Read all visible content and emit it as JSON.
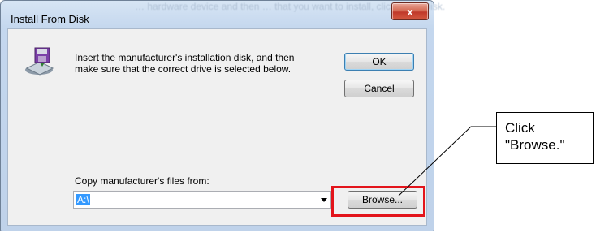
{
  "window": {
    "title": "Install From Disk",
    "background_hint": "… hardware device and then … that you want to install, click Have Disk.",
    "close_glyph": "x"
  },
  "dialog": {
    "message": "Insert the manufacturer's installation disk, and then make sure that the correct drive is selected below.",
    "ok_label": "OK",
    "cancel_label": "Cancel",
    "copy_from_label": "Copy manufacturer's files from:",
    "path_value": "A:\\",
    "browse_label": "Browse..."
  },
  "annotation": {
    "callout_text": "Click \"Browse.\"",
    "highlight_color": "#e3141b"
  },
  "icons": {
    "disk": "install-disk-icon",
    "dropdown": "chevron-down-icon",
    "close": "close-icon"
  }
}
